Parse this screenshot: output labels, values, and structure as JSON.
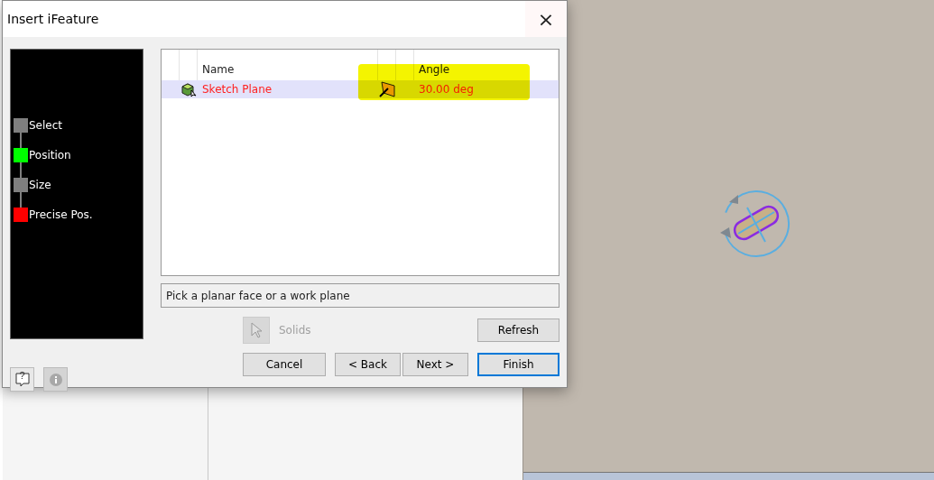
{
  "dialog": {
    "title": "Insert iFeature",
    "close": "×",
    "steps": [
      {
        "label": "Select",
        "color": "#7f7f7f"
      },
      {
        "label": "Position",
        "color": "#00ff00"
      },
      {
        "label": "Size",
        "color": "#7f7f7f"
      },
      {
        "label": "Precise Pos.",
        "color": "#ff0000"
      }
    ],
    "table": {
      "columns": [
        "Name",
        "Angle"
      ],
      "rows": [
        {
          "name": "Sketch Plane",
          "angle": "30.00 deg",
          "selected": true
        }
      ]
    },
    "status": "Pick a planar face or a work plane",
    "solids": {
      "label": "Solids",
      "disabled": true
    },
    "refresh": "Refresh",
    "buttons": [
      {
        "label": "Cancel",
        "default": false
      },
      {
        "label": "< Back",
        "default": false
      },
      {
        "label": "Next >",
        "default": false
      },
      {
        "label": "Finish",
        "default": true
      }
    ],
    "help": "?",
    "info_disabled": true
  }
}
